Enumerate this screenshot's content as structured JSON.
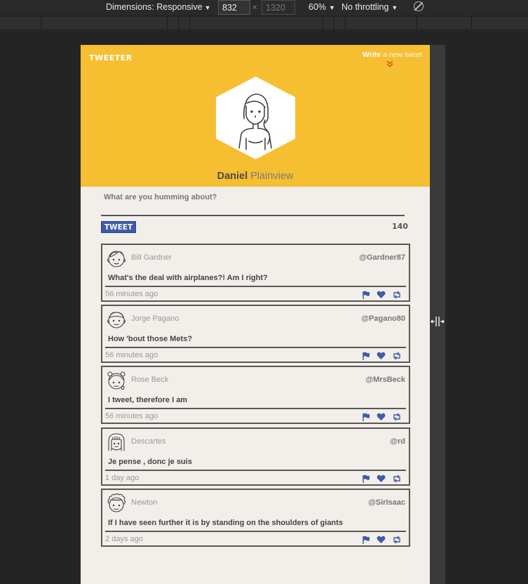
{
  "devtools": {
    "dimensions_label": "Dimensions: Responsive",
    "width": "832",
    "x": "×",
    "height": "1320",
    "zoom": "60%",
    "throttling": "No throttling"
  },
  "app": {
    "logo": "TWEETER",
    "write_bold": "Write",
    "write_rest": " a new tweet",
    "first_name": "Daniel",
    "last_name": "Plainview",
    "compose_placeholder": "What are you humming about?",
    "tweet_button": "TWEET",
    "char_count": "140"
  },
  "tweets": [
    {
      "name": "Bill Gardner",
      "handle": "@Gardner87",
      "text": "What's the deal with airplanes?! Am I right?",
      "time": "56 minutes ago",
      "avatar": "boy-avatar-icon"
    },
    {
      "name": "Jorge Pagano",
      "handle": "@Pagano80",
      "text": "How 'bout those Mets?",
      "time": "56 minutes ago",
      "avatar": "man-avatar-icon"
    },
    {
      "name": "Rose Beck",
      "handle": "@MrsBeck",
      "text": "I tweet, therefore I am",
      "time": "56 minutes ago",
      "avatar": "girl-avatar-icon"
    },
    {
      "name": "Descartes",
      "handle": "@rd",
      "text": "Je pense , donc je suis",
      "time": "1 day ago",
      "avatar": "longhair-avatar-icon"
    },
    {
      "name": "Newton",
      "handle": "@SirIsaac",
      "text": "If I have seen further it is by standing on the shoulders of giants",
      "time": "2 days ago",
      "avatar": "curly-avatar-icon"
    }
  ],
  "colors": {
    "banner": "#f6bf32",
    "accent": "#3f5aa8",
    "chevron": "#e8541d",
    "page_bg": "#f2efea"
  }
}
